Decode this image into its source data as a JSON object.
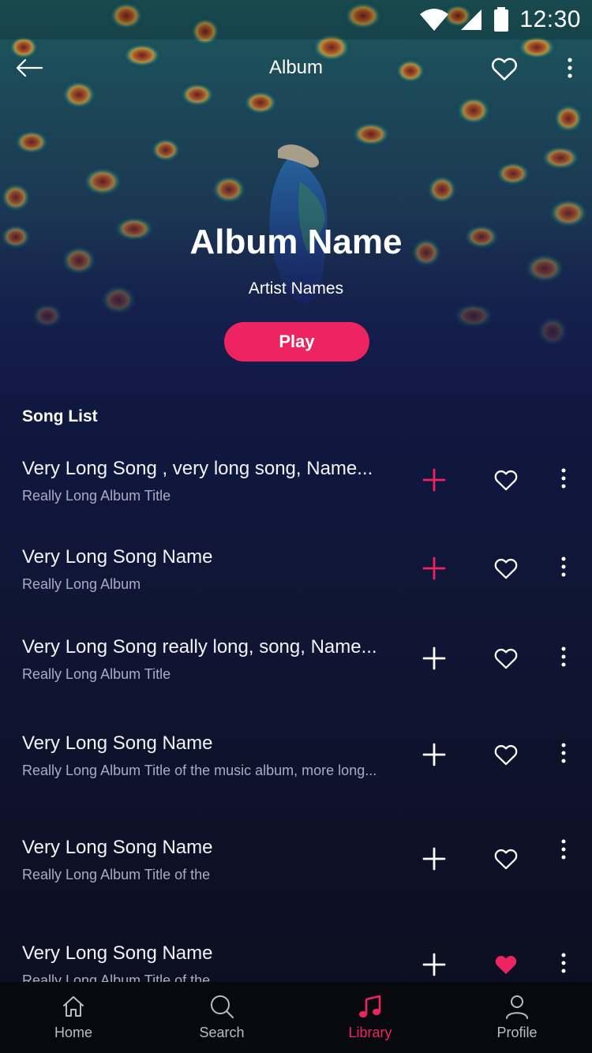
{
  "status_bar": {
    "time": "12:30"
  },
  "app_bar": {
    "title": "Album"
  },
  "album": {
    "name": "Album Name",
    "artists": "Artist Names",
    "play_label": "Play"
  },
  "song_list": {
    "title": "Song List",
    "songs": [
      {
        "title": "Very Long Song , very long song, Name...",
        "album": "Really Long Album Title",
        "added": false,
        "liked": false
      },
      {
        "title": "Very Long Song Name",
        "album": "Really Long Album",
        "added": false,
        "liked": false
      },
      {
        "title": "Very Long Song really long, song, Name...",
        "album": "Really Long Album Title",
        "added": false,
        "liked": false
      },
      {
        "title": "Very Long Song Name",
        "album": "Really Long Album Title of the music album, more long...",
        "added": false,
        "liked": false
      },
      {
        "title": "Very Long Song Name",
        "album": "Really Long Album Title of the",
        "added": false,
        "liked": false
      },
      {
        "title": "Very Long Song Name",
        "album": "Really Long Album Title of the",
        "added": false,
        "liked": true
      }
    ]
  },
  "bottom_nav": {
    "items": [
      {
        "label": "Home",
        "icon": "home-icon",
        "active": false
      },
      {
        "label": "Search",
        "icon": "search-icon",
        "active": false
      },
      {
        "label": "Library",
        "icon": "music-note-icon",
        "active": true
      },
      {
        "label": "Profile",
        "icon": "person-icon",
        "active": false
      }
    ]
  },
  "colors": {
    "accent": "#ee2361",
    "background": "#111842",
    "text_secondary": "#a9adc3"
  }
}
